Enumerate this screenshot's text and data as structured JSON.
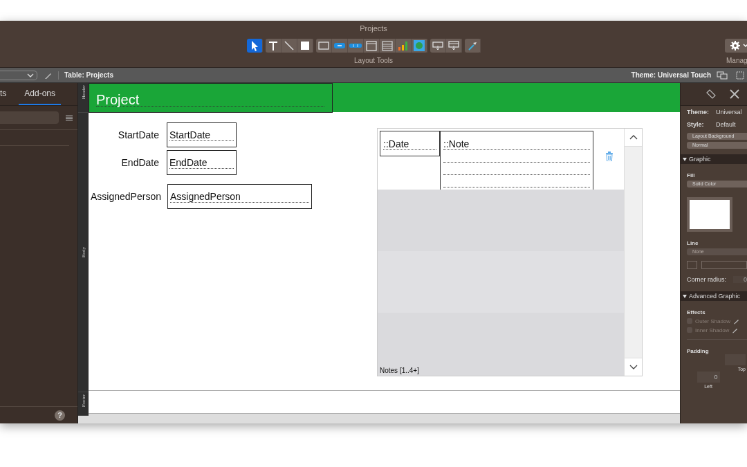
{
  "window": {
    "title": "Projects"
  },
  "toolbar": {
    "groups": [
      [
        {
          "kind": "pointer",
          "selected": true
        }
      ],
      [
        {
          "kind": "text",
          "selected": false
        },
        {
          "kind": "line",
          "selected": false
        },
        {
          "kind": "shape",
          "selected": false
        }
      ],
      [
        {
          "kind": "field",
          "selected": false
        },
        {
          "kind": "button",
          "selected": false
        },
        {
          "kind": "button-bar",
          "selected": false
        },
        {
          "kind": "tab",
          "selected": false
        },
        {
          "kind": "portal",
          "selected": false
        },
        {
          "kind": "chart",
          "selected": false
        },
        {
          "kind": "web",
          "selected": false
        }
      ],
      [
        {
          "kind": "popover",
          "selected": false
        },
        {
          "kind": "slide",
          "selected": false
        }
      ],
      [
        {
          "kind": "eyedropper",
          "selected": false
        }
      ]
    ],
    "label": "Layout Tools",
    "manage_label": "Manag"
  },
  "layout_bar": {
    "table": "Table: Projects",
    "theme": "Theme: Universal Touch"
  },
  "left_pane": {
    "tabs": [
      {
        "label": "ts",
        "selected": false
      },
      {
        "label": "Add-ons",
        "selected": true
      }
    ],
    "help": "?"
  },
  "parts": [
    {
      "label": "Header"
    },
    {
      "label": "Body"
    },
    {
      "label": "Footer"
    }
  ],
  "layout": {
    "header_field": "Project",
    "fields": [
      {
        "label": "StartDate",
        "field": "StartDate"
      },
      {
        "label": "EndDate",
        "field": "EndDate"
      },
      {
        "label": "AssignedPerson",
        "field": "AssignedPerson"
      }
    ],
    "portal": {
      "fields": [
        "::Date",
        "::Note"
      ],
      "label": "Notes [1..4+]"
    }
  },
  "inspector": {
    "theme_label": "Theme:",
    "theme_value": "Universal",
    "style_label": "Style:",
    "style_value": "Default",
    "popups": [
      "Layout Background",
      "Normal"
    ],
    "sections": [
      {
        "title": "Graphic",
        "expanded": true,
        "fill_label": "Fill",
        "fill_value": "Solid Color",
        "line_label": "Line",
        "line_value": "None",
        "corner_label": "Corner radius:",
        "corner_value": "0"
      },
      {
        "title": "Advanced Graphic",
        "expanded": true,
        "effects_label": "Effects",
        "effects": [
          {
            "label": "Outer Shadow",
            "checked": false
          },
          {
            "label": "Inner Shadow",
            "checked": false
          }
        ],
        "padding_label": "Padding",
        "top_label": "Top",
        "left_value": "0",
        "left_label": "Left"
      }
    ]
  }
}
